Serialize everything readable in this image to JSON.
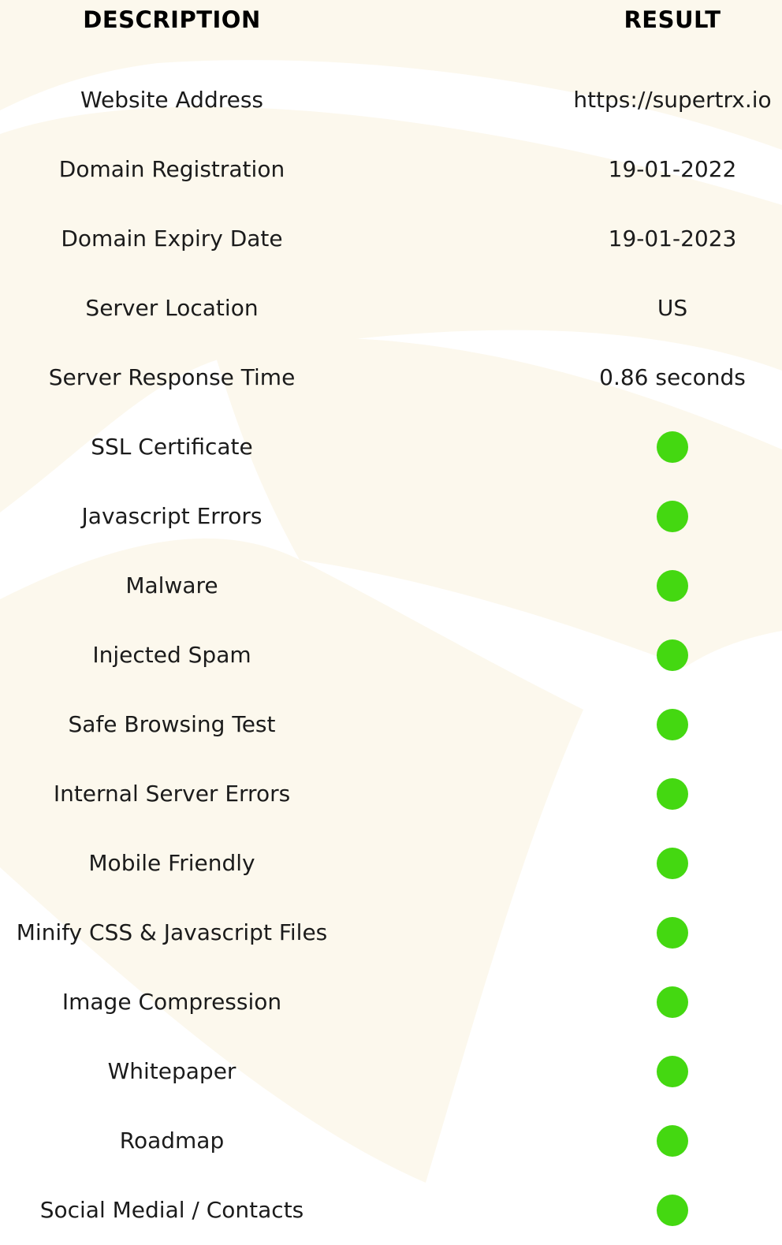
{
  "header": {
    "description": "DESCRIPTION",
    "result": "RESULT"
  },
  "colors": {
    "pass": "#44d811",
    "watermark": "#fcf8ed"
  },
  "rows": [
    {
      "label": "Website Address",
      "value": "https://supertrx.io",
      "status": null
    },
    {
      "label": "Domain Registration",
      "value": "19-01-2022",
      "status": null
    },
    {
      "label": "Domain Expiry Date",
      "value": "19-01-2023",
      "status": null
    },
    {
      "label": "Server Location",
      "value": "US",
      "status": null
    },
    {
      "label": "Server Response Time",
      "value": "0.86 seconds",
      "status": null
    },
    {
      "label": "SSL Certificate",
      "value": null,
      "status": "pass"
    },
    {
      "label": "Javascript Errors",
      "value": null,
      "status": "pass"
    },
    {
      "label": "Malware",
      "value": null,
      "status": "pass"
    },
    {
      "label": "Injected Spam",
      "value": null,
      "status": "pass"
    },
    {
      "label": "Safe Browsing Test",
      "value": null,
      "status": "pass"
    },
    {
      "label": "Internal Server Errors",
      "value": null,
      "status": "pass"
    },
    {
      "label": "Mobile Friendly",
      "value": null,
      "status": "pass"
    },
    {
      "label": "Minify CSS & Javascript Files",
      "value": null,
      "status": "pass"
    },
    {
      "label": "Image Compression",
      "value": null,
      "status": "pass"
    },
    {
      "label": "Whitepaper",
      "value": null,
      "status": "pass"
    },
    {
      "label": "Roadmap",
      "value": null,
      "status": "pass"
    },
    {
      "label": "Social Medial / Contacts",
      "value": null,
      "status": "pass"
    }
  ]
}
